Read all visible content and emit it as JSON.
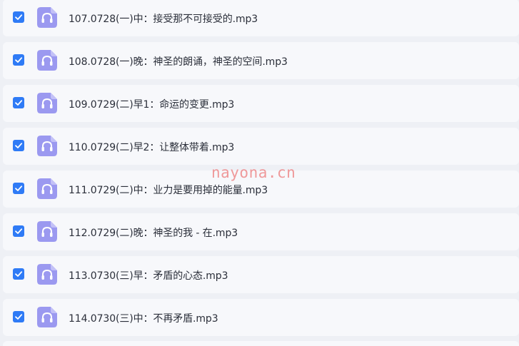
{
  "files": [
    {
      "name": "107.0728(一)中：接受那不可接受的.mp3",
      "checked": true,
      "icon": "headphones-icon"
    },
    {
      "name": "108.0728(一)晚：神圣的朗诵，神圣的空间.mp3",
      "checked": true,
      "icon": "headphones-icon"
    },
    {
      "name": "109.0729(二)早1：命运的变更.mp3",
      "checked": true,
      "icon": "headphones-icon"
    },
    {
      "name": "110.0729(二)早2：让整体带着.mp3",
      "checked": true,
      "icon": "headphones-icon"
    },
    {
      "name": "111.0729(二)中：业力是要用掉的能量.mp3",
      "checked": true,
      "icon": "headphones-icon"
    },
    {
      "name": "112.0729(二)晚：神圣的我 - 在.mp3",
      "checked": true,
      "icon": "headphones-icon"
    },
    {
      "name": "113.0730(三)早：矛盾的心态.mp3",
      "checked": true,
      "icon": "headphones-icon"
    },
    {
      "name": "114.0730(三)中：不再矛盾.mp3",
      "checked": true,
      "icon": "headphones-icon"
    }
  ],
  "watermark": "nayona.cn",
  "colors": {
    "checkbox": "#2f7bf6",
    "icon_bg": "#9b99f0",
    "row_bg": "#f7f8fb",
    "page_bg": "#eef0f5"
  }
}
